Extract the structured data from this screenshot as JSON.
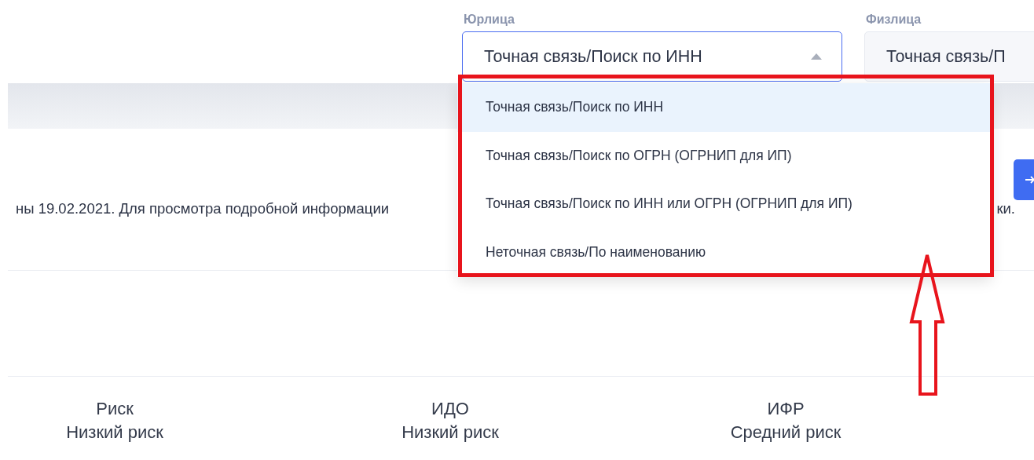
{
  "legal_entity": {
    "label": "Юрлица",
    "value": "Точная связь/Поиск по ИНН",
    "expanded": true,
    "options": [
      {
        "label": "Точная связь/Поиск по ИНН",
        "selected": true
      },
      {
        "label": "Точная связь/Поиск по ОГРН (ОГРНИП для ИП)",
        "selected": false
      },
      {
        "label": "Точная связь/Поиск по ИНН или ОГРН (ОГРНИП для ИП)",
        "selected": false
      },
      {
        "label": "Неточная связь/По наименованию",
        "selected": false
      }
    ]
  },
  "individual": {
    "label": "Физлица",
    "value": "Точная связь/П"
  },
  "notice": {
    "text_left": "ны 19.02.2021. Для просмотра подробной информации",
    "text_right": "ки."
  },
  "metrics": [
    {
      "title": "Риск",
      "value": "Низкий риск"
    },
    {
      "title": "ИДО",
      "value": "Низкий риск"
    },
    {
      "title": "ИФР",
      "value": "Средний риск"
    }
  ]
}
